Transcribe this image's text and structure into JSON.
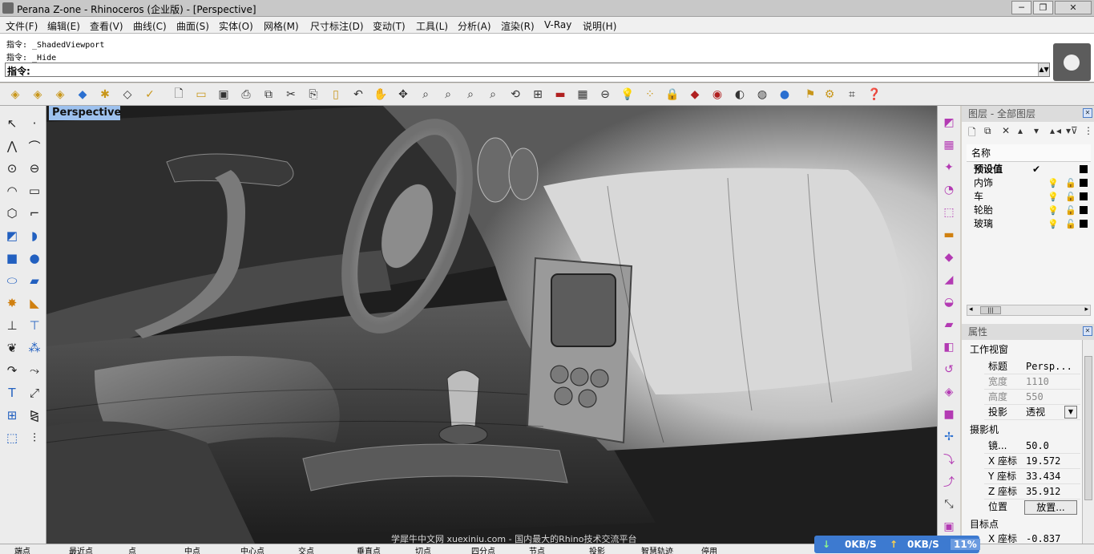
{
  "window": {
    "title": "Perana Z-one - Rhinoceros (企业版) - [Perspective]",
    "minimize": "─",
    "restore": "❐",
    "close": "✕"
  },
  "menu": [
    "文件(F)",
    "编辑(E)",
    "查看(V)",
    "曲线(C)",
    "曲面(S)",
    "实体(O)",
    "网格(M)",
    "尺寸标注(D)",
    "变动(T)",
    "工具(L)",
    "分析(A)",
    "渲染(R)",
    "V-Ray",
    "说明(H)"
  ],
  "command": {
    "history": [
      "指令: _ShadedViewport",
      "指令: _Hide"
    ],
    "prompt": "指令:"
  },
  "viewport": {
    "label": "Perspective",
    "watermark": "学犀牛中文网 xuexiniu.com  - 国内最大的Rhino技术交流平台"
  },
  "layers": {
    "title": "图层 - 全部图层",
    "column_name": "名称",
    "rows": [
      {
        "name": "预设值",
        "current": "✔",
        "bold": true
      },
      {
        "name": "内饰"
      },
      {
        "name": "车"
      },
      {
        "name": "轮胎"
      },
      {
        "name": "玻璃"
      }
    ],
    "scroll_left": "◂",
    "scroll_right": "▸",
    "thumb": "|||"
  },
  "properties": {
    "title": "属性",
    "section_viewport": "工作视窗",
    "fields_viewport": [
      {
        "k": "标题",
        "v": "Persp..."
      },
      {
        "k": "宽度",
        "v": "1110"
      },
      {
        "k": "高度",
        "v": "550"
      },
      {
        "k": "投影",
        "v": "透视"
      }
    ],
    "section_camera": "摄影机",
    "fields_camera": [
      {
        "k": "镜...",
        "v": "50.0"
      },
      {
        "k": "X 座标",
        "v": "19.572"
      },
      {
        "k": "Y 座标",
        "v": "33.434"
      },
      {
        "k": "Z 座标",
        "v": "35.912"
      },
      {
        "k": "位置",
        "v": ""
      }
    ],
    "place_button": "放置...",
    "section_target": "目标点",
    "fields_target": [
      {
        "k": "X 座标",
        "v": "-0.837"
      }
    ]
  },
  "status": [
    "端点",
    "最近点",
    "点",
    "中点",
    "中心点",
    "交点",
    "垂直点",
    "切点",
    "四分点",
    "节点",
    "投影",
    "智慧轨迹",
    "停用"
  ],
  "network": {
    "down": "0KB/S",
    "up": "0KB/S",
    "cpu": "11%"
  },
  "colors": {
    "accent": "#3d7ad0",
    "tab": "#9dc1ee"
  }
}
